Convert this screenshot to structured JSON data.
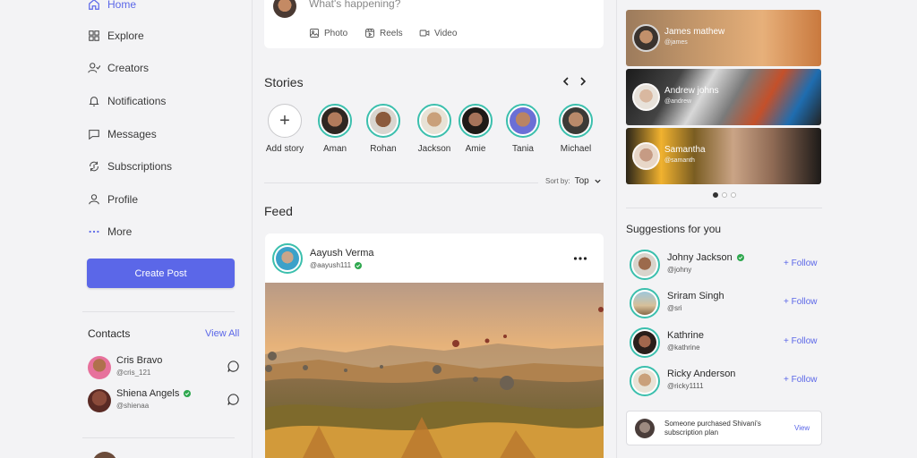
{
  "nav": {
    "items": [
      {
        "label": "Home",
        "icon": "home-icon",
        "active": true
      },
      {
        "label": "Explore",
        "icon": "grid-icon"
      },
      {
        "label": "Creators",
        "icon": "user-check-icon"
      },
      {
        "label": "Notifications",
        "icon": "bell-icon"
      },
      {
        "label": "Messages",
        "icon": "message-icon"
      },
      {
        "label": "Subscriptions",
        "icon": "refresh-dollar-icon"
      },
      {
        "label": "Profile",
        "icon": "user-icon"
      },
      {
        "label": "More",
        "icon": "ellipsis-icon"
      }
    ],
    "create_post": "Create Post"
  },
  "contacts": {
    "title": "Contacts",
    "view_all": "View All",
    "items": [
      {
        "name": "Cris Bravo",
        "handle": "@cris_121",
        "verified": false
      },
      {
        "name": "Shiena Angels",
        "handle": "@shienaa",
        "verified": true
      }
    ]
  },
  "compose": {
    "placeholder": "What's happening?",
    "actions": [
      {
        "label": "Photo",
        "icon": "image-icon"
      },
      {
        "label": "Reels",
        "icon": "reels-icon"
      },
      {
        "label": "Video",
        "icon": "video-icon"
      }
    ]
  },
  "stories": {
    "title": "Stories",
    "add_label": "Add story",
    "items": [
      {
        "name": "Aman"
      },
      {
        "name": "Rohan"
      },
      {
        "name": "Jackson"
      },
      {
        "name": "Amie"
      },
      {
        "name": "Tania"
      },
      {
        "name": "Michael"
      }
    ]
  },
  "sort": {
    "label": "Sort by:",
    "value": "Top"
  },
  "feed": {
    "title": "Feed",
    "post": {
      "name": "Aayush Verma",
      "handle": "@aayush111",
      "verified": true
    }
  },
  "subscriptions": [
    {
      "name": "James mathew",
      "handle": "@james"
    },
    {
      "name": "Andrew johns",
      "handle": "@andrew"
    },
    {
      "name": "Samantha",
      "handle": "@samanth"
    }
  ],
  "suggestions": {
    "title": "Suggestions for you",
    "follow_label": "+ Follow",
    "items": [
      {
        "name": "Johny Jackson",
        "handle": "@johny",
        "verified": true
      },
      {
        "name": "Sriram Singh",
        "handle": "@sri",
        "verified": false
      },
      {
        "name": "Kathrine",
        "handle": "@kathrine",
        "verified": false
      },
      {
        "name": "Ricky Anderson",
        "handle": "@ricky1111",
        "verified": false
      }
    ]
  },
  "notice": {
    "text": "Someone purchased Shivani's subscription plan",
    "action": "View"
  },
  "colors": {
    "accent": "#5b67e8",
    "story_ring": "#3bbfad",
    "verified": "#2fa84f"
  }
}
